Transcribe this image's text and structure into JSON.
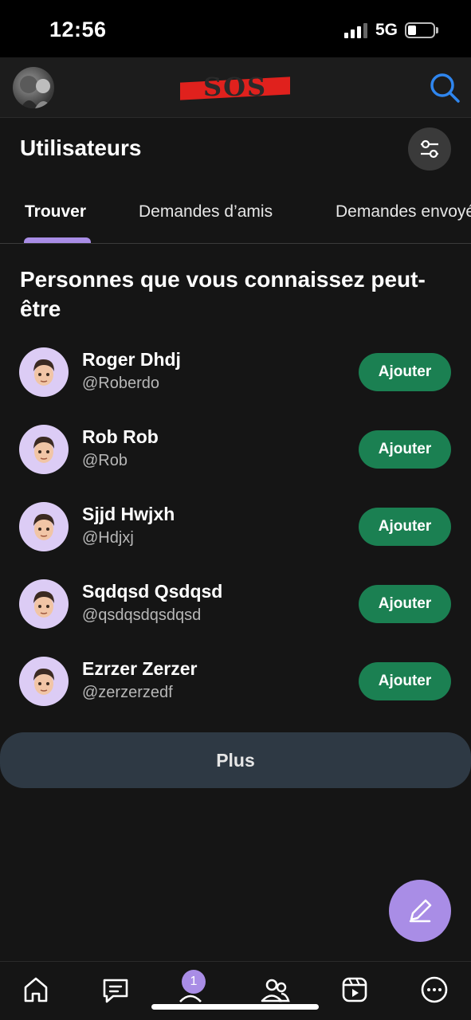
{
  "status_bar": {
    "time": "12:56",
    "network": "5G"
  },
  "header": {
    "logo_text": "SOS",
    "search_icon": "search-icon"
  },
  "page": {
    "title": "Utilisateurs"
  },
  "tabs": [
    {
      "label": "Trouver",
      "active": true
    },
    {
      "label": "Demandes d’amis",
      "active": false
    },
    {
      "label": "Demandes envoyées",
      "active": false
    }
  ],
  "section": {
    "title": "Personnes que vous connaissez peut-être"
  },
  "users": [
    {
      "name": "Roger Dhdj",
      "handle": "@Roberdo",
      "action": "Ajouter"
    },
    {
      "name": "Rob Rob",
      "handle": "@Rob",
      "action": "Ajouter"
    },
    {
      "name": "Sjjd Hwjxh",
      "handle": "@Hdjxj",
      "action": "Ajouter"
    },
    {
      "name": "Sqdqsd Qsdqsd",
      "handle": "@qsdqsdqsdqsd",
      "action": "Ajouter"
    },
    {
      "name": "Ezrzer Zerzer",
      "handle": "@zerzerzedf",
      "action": "Ajouter"
    }
  ],
  "more_button": {
    "label": "Plus"
  },
  "bottom_nav": {
    "badge_count": "1",
    "items": [
      "home-icon",
      "messages-icon",
      "profile-icon",
      "friends-icon",
      "reels-icon",
      "more-icon"
    ]
  },
  "colors": {
    "accent": "#a98de6",
    "add_button": "#1b8052",
    "more_button": "#2e3944",
    "search_icon": "#2f86ef",
    "logo_stripe": "#e0211d"
  }
}
